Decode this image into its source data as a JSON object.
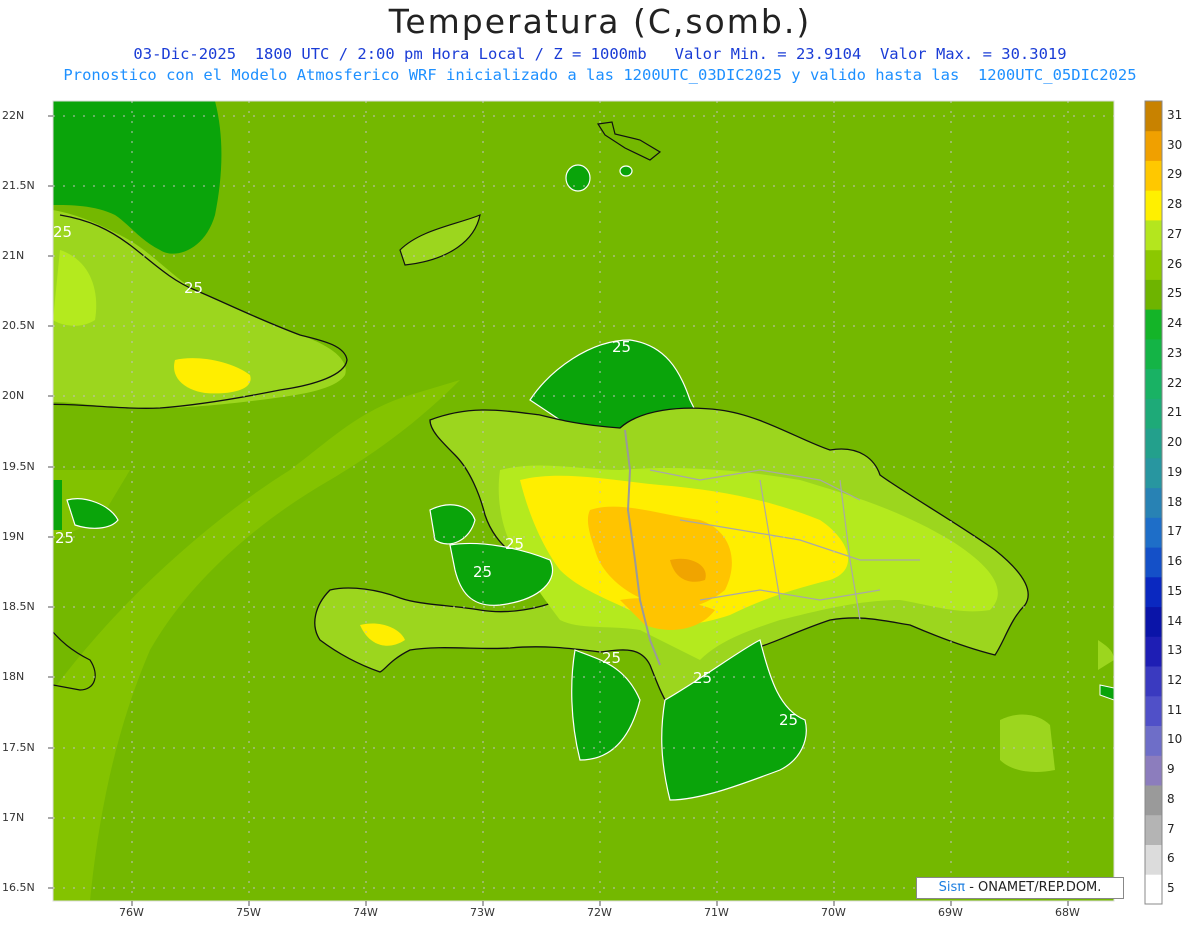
{
  "header": {
    "title": "Temperatura (C,somb.)",
    "line1": "03-Dic-2025  1800 UTC / 2:00 pm Hora Local / Z = 1000mb   Valor Min. = 23.9104  Valor Max. = 30.3019",
    "line2": "Pronostico con el Modelo Atmosferico WRF inicializado a las 1200UTC_03DIC2025 y valido hasta las  1200UTC_05DIC2025"
  },
  "axes": {
    "lat_labels": [
      "22N",
      "21.5N",
      "21N",
      "20.5N",
      "20N",
      "19.5N",
      "19N",
      "18.5N",
      "18N",
      "17.5N",
      "17N",
      "16.5N"
    ],
    "lon_labels": [
      "76W",
      "75W",
      "74W",
      "73W",
      "72W",
      "71W",
      "70W",
      "69W",
      "68W"
    ]
  },
  "colorbar": {
    "levels": [
      "5",
      "6",
      "7",
      "8",
      "9",
      "10",
      "11",
      "12",
      "13",
      "14",
      "15",
      "16",
      "17",
      "18",
      "19",
      "20",
      "21",
      "22",
      "23",
      "24",
      "25",
      "26",
      "27",
      "28",
      "29",
      "30",
      "31"
    ],
    "colors": [
      "#ffffff",
      "#dcdcdc",
      "#b4b4b4",
      "#9a9a9a",
      "#8c7dbd",
      "#6e6ec8",
      "#5050c8",
      "#3a3ac0",
      "#1e1eb4",
      "#0a14a8",
      "#0a28c0",
      "#1450c8",
      "#1e6ec8",
      "#2882b4",
      "#2896a0",
      "#23a08c",
      "#1eaa78",
      "#19b264",
      "#14b446",
      "#14b428",
      "#6eb400",
      "#8cc800",
      "#b4e61e",
      "#fff000",
      "#ffc800",
      "#f0a000",
      "#c88200"
    ]
  },
  "map": {
    "contour_label": "25",
    "colors": {
      "base": "#74b800",
      "dark": "#0aa40a",
      "light": "#9cd61e",
      "lighter": "#b4ea1e",
      "yellow": "#ffee00",
      "orange": "#ffc400",
      "dorange": "#f0a400"
    }
  },
  "credit": {
    "brand": "Sisπ",
    "text": " - ONAMET/REP.DOM."
  }
}
